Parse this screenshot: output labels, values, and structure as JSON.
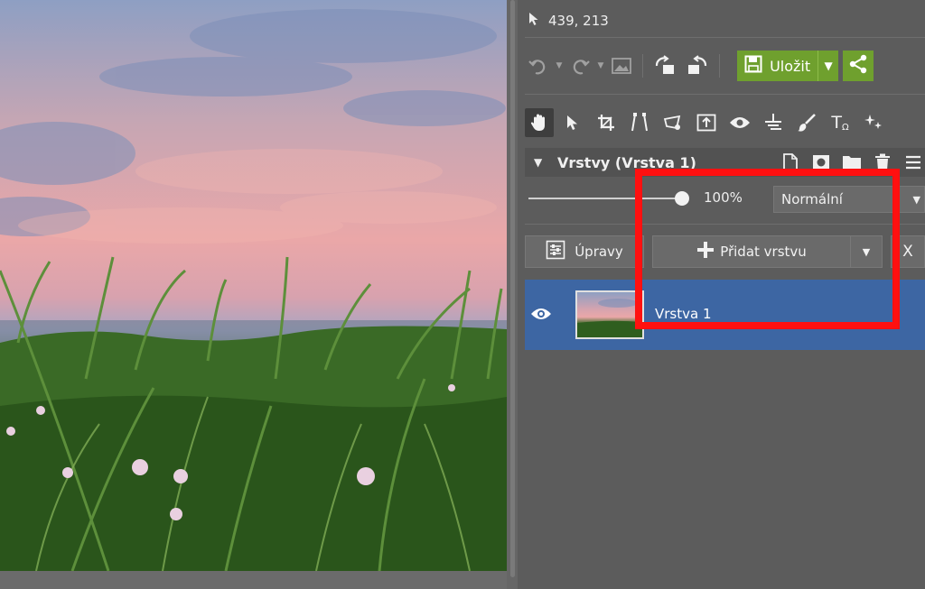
{
  "canvas": {
    "image": "sunset-meadow-photo",
    "colors": {
      "sky_top": "#8e9fc3",
      "sky_glow": "#eaa7a8",
      "grass": "#2d5a1e"
    }
  },
  "status": {
    "cursor_icon": "cursor-arrow-icon",
    "coordinates": "439, 213"
  },
  "toolbar": {
    "undo_icon": "undo-icon",
    "redo_icon": "redo-icon",
    "image_icon": "image-icon",
    "rotate_left_icon": "rotate-left-icon",
    "rotate_right_icon": "rotate-right-icon",
    "save_label": "Uložit",
    "save_icon": "floppy-disk-icon",
    "share_icon": "share-icon",
    "accent": "#6fa02e"
  },
  "tools": [
    "hand-icon",
    "pointer-icon",
    "crop-icon",
    "perspective-icon",
    "transform-icon",
    "export-box-icon",
    "eye-icon",
    "level-icon",
    "brush-icon",
    "text-icon",
    "effects-icon"
  ],
  "layers": {
    "title": "Vrstvy (Vrstva 1)",
    "opacity": "100%",
    "opacity_fraction": 1.0,
    "blend_mode": "Normální",
    "adjust_label": "Úpravy",
    "add_layer_label": "Přidat vrstvu",
    "close_label": "X",
    "items": [
      {
        "name": "Vrstva 1",
        "visible": true,
        "selected": true
      }
    ],
    "selected_color": "#3d66a3"
  },
  "annotation": {
    "color": "#ff1010"
  }
}
